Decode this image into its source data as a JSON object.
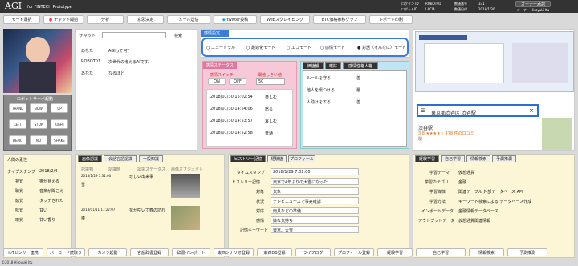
{
  "header": {
    "title": "AGI",
    "subtitle": "for FINTECH Prototype",
    "info": [
      [
        "ログイン ID",
        "ROBOT01",
        "数値番号",
        "331"
      ],
      [
        "ロボットID",
        "LACIA",
        "数値日付",
        "2018/1/30"
      ]
    ],
    "owner_btn": "オーナー承認",
    "user": "オーナー Hiroyuki Itu"
  },
  "toolbar": [
    "モード選択",
    "チャット開始",
    "分析",
    "意思決定",
    "メール送信",
    "twitter投稿",
    "Webスクレイピング",
    "BTC価格推移グラフ",
    "レポート印刷"
  ],
  "chat": {
    "title": "チャット",
    "search": "検索",
    "rows": [
      [
        "あなた",
        "AGIって何？"
      ],
      [
        "ROBOT01",
        "次世代の考えるAIです。"
      ],
      [
        "あなた",
        "なるほど"
      ]
    ]
  },
  "robot": {
    "title": "ロボットサーボ起動",
    "buttons": [
      "THANK",
      "BOW",
      "UP",
      "LEFT",
      "STOP",
      "RIGHT",
      "DEMO",
      "NO",
      "SHAKE"
    ]
  },
  "emotion": {
    "title": "感情設定",
    "options": [
      "ニュートラル",
      "最適化モード",
      "エコモード",
      "感情モード",
      "対話（そんなに）モード"
    ],
    "selected": 4
  },
  "status": {
    "title": "感情ステータス",
    "switch_label": "感情スイッチ",
    "threshold_label": "閾値しきい値",
    "on": "ON",
    "off": "OFF",
    "threshold": "50",
    "log": [
      [
        "2018/01/30 15:02:54",
        "楽しむ"
      ],
      [
        "2018/01/30 14:54:06",
        "怒る"
      ],
      [
        "2018/01/30 14:53:57",
        "哀しむ"
      ],
      [
        "2018/01/30 14:52:58",
        "普通"
      ]
    ]
  },
  "values": {
    "tabs": [
      "価値観",
      "嗜好",
      "感情性格人格"
    ],
    "rows": [
      [
        "ルールを守る",
        "善"
      ],
      [
        "他人を傷つける",
        "悪"
      ],
      [
        "人助けをする",
        "善"
      ]
    ]
  },
  "map": {
    "query": "東京都渋谷区 渋谷駅",
    "place": "渋谷駅",
    "rating": "3.8 ★★★★☆ 478 件の口コミ",
    "sub": "駅"
  },
  "profile": {
    "title": "人間の素性",
    "rows": [
      [
        "タイプスタンプ",
        "2018/2/4"
      ],
      [
        "視覚",
        "猫が見える"
      ],
      [
        "聴覚",
        "音楽が聞こえ"
      ],
      [
        "触覚",
        "タッチされた"
      ],
      [
        "味覚",
        "甘い"
      ],
      [
        "嗅覚",
        "甘い香り"
      ]
    ]
  },
  "image": {
    "tabs": [
      "画像認識",
      "会話言語認識",
      "一般知識"
    ],
    "headers": [
      "認識物",
      "認識時",
      "認識ステータス",
      "画像オブジェクト"
    ],
    "rows": [
      [
        "2018/1/29 7:31:00",
        "雪",
        "珍しい出来事"
      ],
      [
        "2018/01/11 17:22:07",
        "棒",
        "花が咲いて春の訪れ"
      ]
    ]
  },
  "history": {
    "tabs": [
      "ヒストリー記憶",
      "経験値",
      "プロフィール"
    ],
    "rows": [
      [
        "タイムスタンプ",
        "2018/1/29 7:31:00"
      ],
      [
        "ヒストリー記憶",
        "東京で4年ぶりの大雪になった"
      ],
      [
        "対象",
        "気象"
      ],
      [
        "状況",
        "テレビニュースで事実確認"
      ],
      [
        "対応",
        "雨具などの準備"
      ],
      [
        "感情",
        "嫌な気持ち"
      ],
      [
        "記憶キーワード",
        "東京、大雪"
      ]
    ]
  },
  "learning": {
    "tabs": [
      "経験学習",
      "自己学習",
      "情報検索",
      "予測推測"
    ],
    "rows": [
      [
        "学習テーマ",
        "仮想通貨"
      ],
      [
        "学習カテゴリ",
        "金融"
      ],
      [
        "学習媒体",
        "関連テーブル   外部データベース   API"
      ],
      [
        "学習方法",
        "キーワード検索による データベース作成"
      ],
      [
        "インポートデータ",
        "金融情報データベース"
      ],
      [
        "アウトプットデータ",
        "仮想通貨関連情報"
      ]
    ]
  },
  "bottom": [
    "IoTセンサー連携",
    "バーコード読取り",
    "カメラ起動",
    "言語辞書登録",
    "辞書インポート",
    "東西シナリオ登録",
    "東西DB登録",
    "ライフログ",
    "プロフィール登録",
    "経験学習",
    "自己学習",
    "情報検索",
    "予測推測"
  ],
  "footer": "©2018 Hiroyuki Itu",
  "colors": {
    "accent": "#2a6fd8",
    "pink": "#f2a6c1",
    "blue": "#3b7dd8"
  }
}
